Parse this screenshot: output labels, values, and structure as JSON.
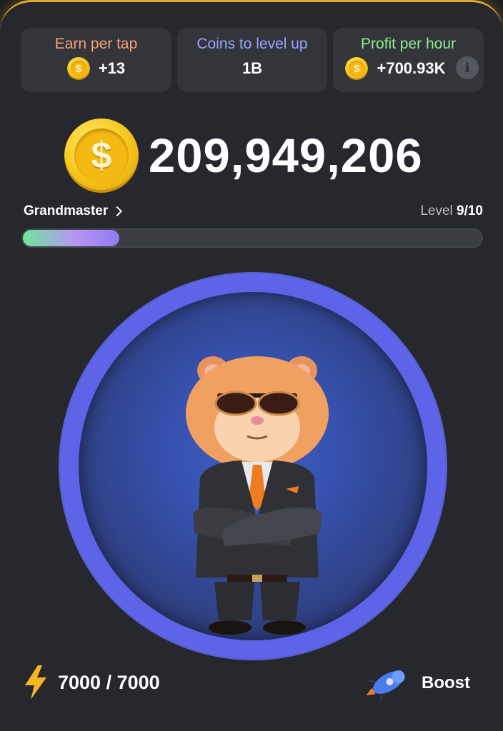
{
  "stats": [
    {
      "label": "Earn per tap",
      "value": "+13",
      "label_color": "#f4a17a",
      "coin": "coin-icon"
    },
    {
      "label": "Coins to level up",
      "value": "1B",
      "label_color": "#9aa3ff"
    },
    {
      "label": "Profit per hour",
      "value": "+700.93K",
      "label_color": "#8fec8f",
      "coin": "coin-icon",
      "info_icon": "info-icon"
    }
  ],
  "coin_glyph": "$",
  "info_glyph": "i",
  "balance": {
    "value": "209,949,206"
  },
  "rank": {
    "name": "Grandmaster",
    "level_label": "Level",
    "level_value": "9/10",
    "progress_fraction": 0.21
  },
  "energy": {
    "value": "7000 / 7000",
    "icon": "lightning-icon"
  },
  "boost": {
    "label": "Boost",
    "icon": "rocket-icon"
  },
  "colors": {
    "accent_gold": "#e3a928",
    "tap_ring": "#5b62e6",
    "progress_start": "#6ee79a",
    "progress_end": "#b794f6"
  }
}
